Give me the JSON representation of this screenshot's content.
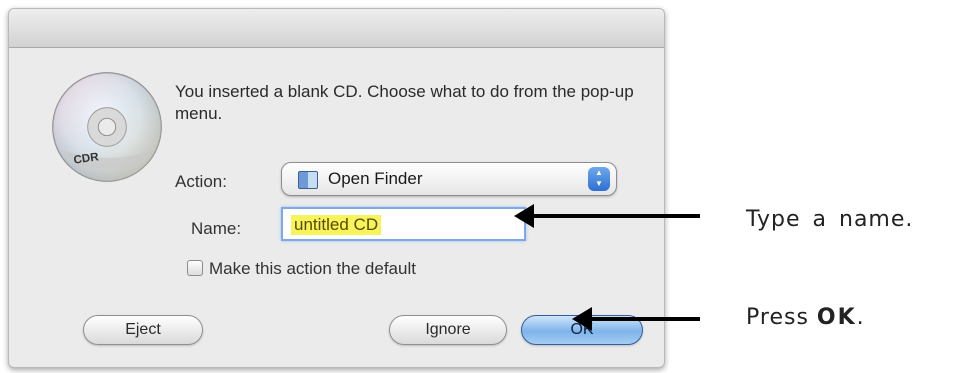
{
  "dialog": {
    "message": "You inserted a blank CD. Choose what to do from the pop-up menu.",
    "icon_label": "CDR",
    "action_label": "Action:",
    "action_value": "Open Finder",
    "name_label": "Name:",
    "name_value": "untitled CD",
    "checkbox_label": "Make this action the default",
    "checkbox_checked": false,
    "buttons": {
      "eject": "Eject",
      "ignore": "Ignore",
      "ok": "OK"
    }
  },
  "callouts": {
    "name_instruction": "Type a name.",
    "ok_prefix": "Press",
    "ok_bold": "OK",
    "ok_suffix": "."
  },
  "colors": {
    "name_highlight": "#f7f35a",
    "default_button": "#7fb4ea",
    "arrow": "#000000"
  },
  "icons": [
    "cdr-disc-icon",
    "finder-icon",
    "popup-arrows-icon",
    "arrow-left-icon"
  ]
}
